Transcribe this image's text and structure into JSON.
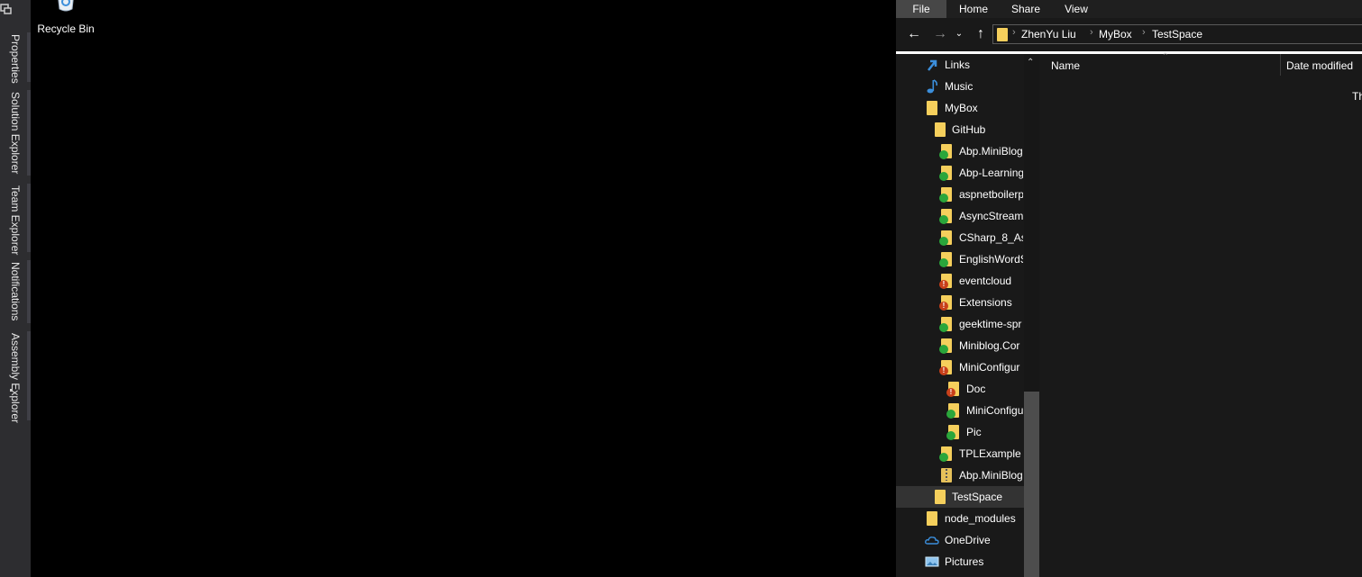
{
  "vs_strip": {
    "tabs": [
      "Properties",
      "Solution Explorer",
      "Team Explorer",
      "Notifications",
      "Assembly Explorer"
    ]
  },
  "desktop": {
    "recycle_bin_label": "Recycle Bin"
  },
  "explorer": {
    "ribbon_tabs": [
      "File",
      "Home",
      "Share",
      "View"
    ],
    "breadcrumb": [
      "ZhenYu Liu",
      "MyBox",
      "TestSpace"
    ],
    "tree": [
      {
        "label": "Links",
        "icon": "links-icon"
      },
      {
        "label": "Music",
        "icon": "music-icon"
      },
      {
        "label": "MyBox",
        "icon": "folder-icon"
      },
      {
        "label": "GitHub",
        "icon": "folder-icon"
      },
      {
        "label": "Abp.MiniBlog",
        "icon": "git-synced-folder-icon"
      },
      {
        "label": "Abp-Learning",
        "icon": "git-synced-folder-icon"
      },
      {
        "label": "aspnetboilerp",
        "icon": "git-synced-folder-icon"
      },
      {
        "label": "AsyncStream",
        "icon": "git-synced-folder-icon"
      },
      {
        "label": "CSharp_8_Asy",
        "icon": "git-synced-folder-icon"
      },
      {
        "label": "EnglishWordS",
        "icon": "git-synced-folder-icon"
      },
      {
        "label": "eventcloud",
        "icon": "git-modified-folder-icon"
      },
      {
        "label": "Extensions",
        "icon": "git-modified-folder-icon"
      },
      {
        "label": "geektime-spr",
        "icon": "git-synced-folder-icon"
      },
      {
        "label": "Miniblog.Cor",
        "icon": "git-synced-folder-icon"
      },
      {
        "label": "MiniConfigur",
        "icon": "git-modified-folder-icon"
      },
      {
        "label": "Doc",
        "icon": "git-modified-folder-icon"
      },
      {
        "label": "MiniConfigu",
        "icon": "git-synced-folder-icon"
      },
      {
        "label": "Pic",
        "icon": "git-synced-folder-icon"
      },
      {
        "label": "TPLExample",
        "icon": "git-synced-folder-icon"
      },
      {
        "label": "Abp.MiniBlog",
        "icon": "zip-folder-icon"
      },
      {
        "label": "TestSpace",
        "icon": "folder-icon",
        "selected": true
      },
      {
        "label": "node_modules",
        "icon": "folder-icon"
      },
      {
        "label": "OneDrive",
        "icon": "onedrive-icon"
      },
      {
        "label": "Pictures",
        "icon": "pictures-icon"
      }
    ],
    "columns": [
      "Name",
      "Date modified"
    ],
    "empty_text": "Th"
  },
  "colors": {
    "folder": "#f5cf5c",
    "synced_badge": "#2aa63b",
    "modified_badge": "#c8401a",
    "selection": "#333333"
  }
}
